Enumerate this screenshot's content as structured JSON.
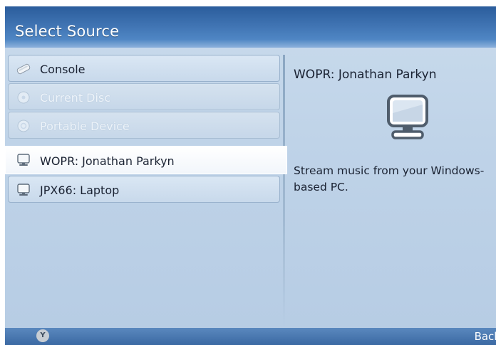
{
  "header": {
    "title": "Select Source"
  },
  "sources": [
    {
      "label": "Console",
      "icon": "console-icon",
      "state": "normal"
    },
    {
      "label": "Current Disc",
      "icon": "disc-icon",
      "state": "disabled"
    },
    {
      "label": "Portable Device",
      "icon": "portable-device-icon",
      "state": "disabled"
    },
    {
      "label": "WOPR: Jonathan Parkyn",
      "icon": "pc-monitor-icon",
      "state": "selected"
    },
    {
      "label": "JPX66: Laptop",
      "icon": "pc-monitor-icon",
      "state": "normal"
    }
  ],
  "details": {
    "title": "WOPR: Jonathan Parkyn",
    "icon": "pc-monitor-icon",
    "description": "Stream music from your Windows-based PC."
  },
  "footer": {
    "y_button": "Y",
    "back_label": "Back"
  },
  "colors": {
    "header": "#3f73b2",
    "background": "#c3d6ea",
    "selected": "#ffffff"
  }
}
